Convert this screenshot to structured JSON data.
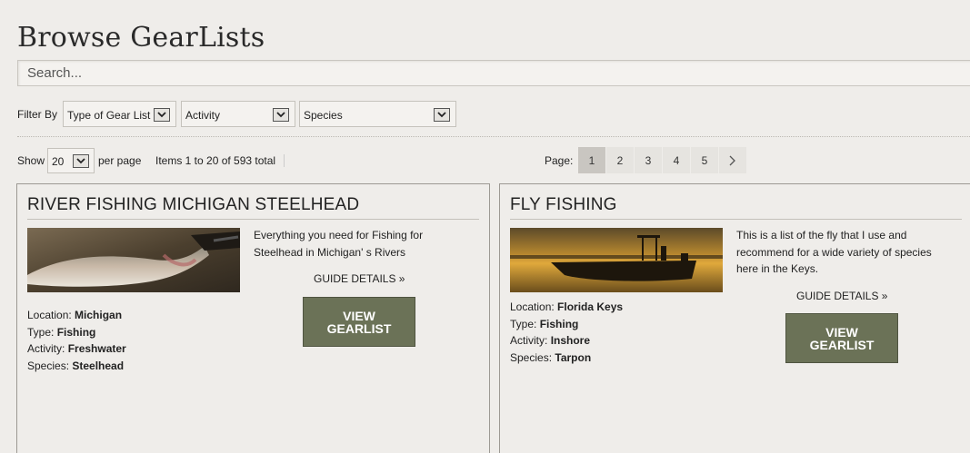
{
  "page_title": "Browse GearLists",
  "search": {
    "placeholder": "Search..."
  },
  "filters": {
    "label": "Filter By",
    "type_of_gear_list": "Type of Gear List",
    "activity": "Activity",
    "species": "Species"
  },
  "listing": {
    "show_label": "Show",
    "per_page_value": "20",
    "per_page_label": "per page",
    "items_summary": "Items 1 to 20 of 593 total",
    "page_label": "Page:",
    "pages": [
      "1",
      "2",
      "3",
      "4",
      "5"
    ],
    "current_page": "1"
  },
  "cards": [
    {
      "title": "RIVER FISHING MICHIGAN STEELHEAD",
      "description": "Everything you need for Fishing for Steelhead in Michigan' s Rivers",
      "guide_label": "GUIDE DETAILS »",
      "button_line1": "VIEW",
      "button_line2": "GEARLIST",
      "location_label": "Location:",
      "location": "Michigan",
      "type_label": "Type:",
      "type": "Fishing",
      "activity_label": "Activity:",
      "activity": "Freshwater",
      "species_label": "Species:",
      "species": "Steelhead"
    },
    {
      "title": "FLY FISHING",
      "description": "This is a list of the fly that I use and recommend for a wide variety of species here in the Keys.",
      "guide_label": "GUIDE DETAILS »",
      "button_line1": "VIEW",
      "button_line2": "GEARLIST",
      "location_label": "Location:",
      "location": "Florida Keys",
      "type_label": "Type:",
      "type": "Fishing",
      "activity_label": "Activity:",
      "activity": "Inshore",
      "species_label": "Species:",
      "species": "Tarpon"
    }
  ]
}
